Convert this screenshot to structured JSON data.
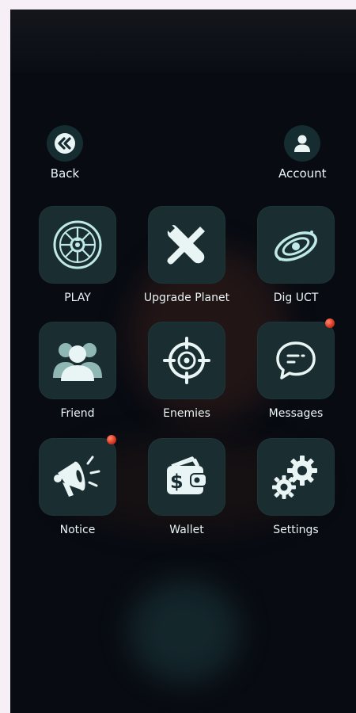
{
  "colors": {
    "overlay_bg": "#080b12",
    "tile_bg": "#1a2e31",
    "icon_color": "#bfe9e6",
    "label_color": "#e9f4f4",
    "notification_dot": "#d8331f"
  },
  "nav": {
    "back_label": "Back",
    "back_icon": "double-chevron-left-icon",
    "account_label": "Account",
    "account_icon": "user-icon"
  },
  "menu": {
    "items": [
      {
        "label": "PLAY",
        "icon": "compass-wheel-icon",
        "notification": false
      },
      {
        "label": "Upgrade Planet",
        "icon": "wrench-screwdriver-icon",
        "notification": false
      },
      {
        "label": "Dig UCT",
        "icon": "galaxy-icon",
        "notification": false
      },
      {
        "label": "Friend",
        "icon": "friends-icon",
        "notification": false
      },
      {
        "label": "Enemies",
        "icon": "crosshair-icon",
        "notification": false
      },
      {
        "label": "Messages",
        "icon": "chat-bubble-icon",
        "notification": true
      },
      {
        "label": "Notice",
        "icon": "megaphone-icon",
        "notification": true
      },
      {
        "label": "Wallet",
        "icon": "wallet-icon",
        "notification": false
      },
      {
        "label": "Settings",
        "icon": "gears-icon",
        "notification": false
      }
    ]
  }
}
